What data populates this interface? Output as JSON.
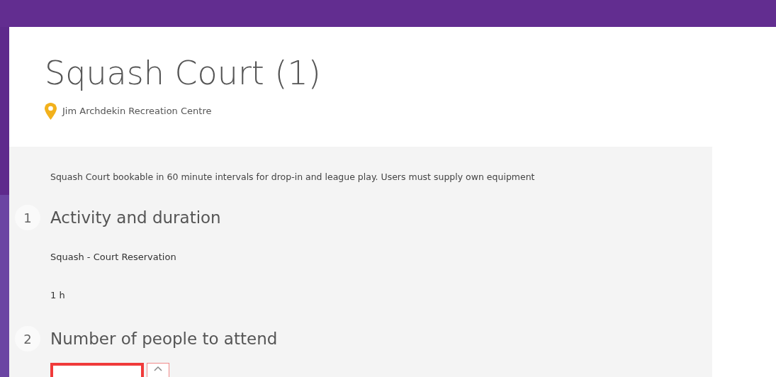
{
  "title": "Squash Court (1)",
  "location": "Jim Archdekin Recreation Centre",
  "description": "Squash Court bookable in 60 minute intervals for drop-in and league play. Users must supply own equipment",
  "steps": [
    {
      "number": "1",
      "heading": "Activity and duration",
      "lines": [
        "Squash - Court Reservation",
        "1 h"
      ]
    },
    {
      "number": "2",
      "heading": "Number of people to attend",
      "field": {
        "invalid": true
      }
    }
  ]
}
